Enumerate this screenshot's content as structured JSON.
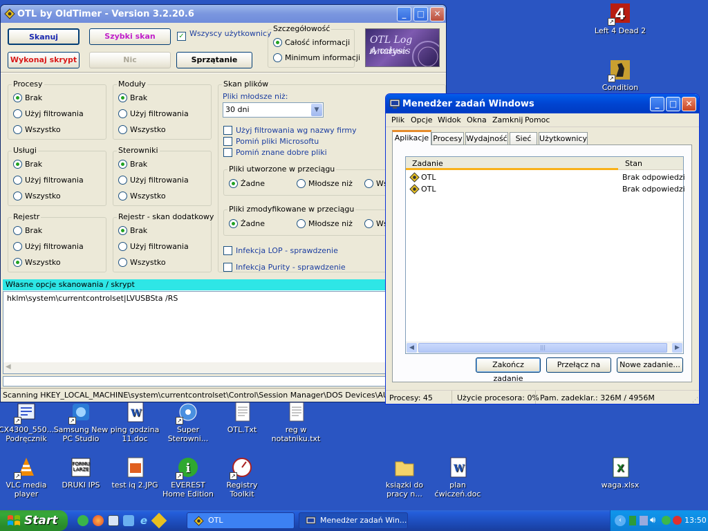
{
  "desktop_icons": [
    {
      "id": "l4d2",
      "label": "Left 4 Dead 2",
      "icon": "l4d2-icon",
      "shortcut": true
    },
    {
      "id": "cz",
      "label": "Condition Zero",
      "icon": "counter-strike-icon",
      "shortcut": true
    },
    {
      "id": "cx4300",
      "label": "CX4300_550... Podręcznik",
      "icon": "printer-manual-icon",
      "shortcut": true
    },
    {
      "id": "samsung",
      "label": "Samsung New PC Studio",
      "icon": "samsung-pc-studio-icon",
      "shortcut": true
    },
    {
      "id": "ping",
      "label": "ping godzina 11.doc",
      "icon": "word-document-icon",
      "shortcut": false
    },
    {
      "id": "super",
      "label": "Super Sterowni...",
      "icon": "driver-tool-icon",
      "shortcut": true
    },
    {
      "id": "otltxt",
      "label": "OTL.Txt",
      "icon": "text-file-icon",
      "shortcut": false
    },
    {
      "id": "reg",
      "label": "reg w notatniku.txt",
      "icon": "text-file-icon",
      "shortcut": false
    },
    {
      "id": "vlc",
      "label": "VLC media player",
      "icon": "vlc-icon",
      "shortcut": true
    },
    {
      "id": "druki",
      "label": "DRUKI IPS",
      "icon": "forms-icon",
      "shortcut": false
    },
    {
      "id": "testiq",
      "label": "test iq 2.JPG",
      "icon": "image-file-icon",
      "shortcut": false
    },
    {
      "id": "everest",
      "label": "EVEREST Home Edition",
      "icon": "everest-info-icon",
      "shortcut": true
    },
    {
      "id": "regtool",
      "label": "Registry Toolkit",
      "icon": "registry-toolkit-icon",
      "shortcut": true
    },
    {
      "id": "ksiazki",
      "label": "ksiązki do pracy n...",
      "icon": "folder-icon",
      "shortcut": false
    },
    {
      "id": "plan",
      "label": "plan ćwiczeń.doc",
      "icon": "word-document-icon",
      "shortcut": false
    },
    {
      "id": "waga",
      "label": "waga.xlsx",
      "icon": "excel-file-icon",
      "shortcut": false
    }
  ],
  "otl": {
    "title": "OTL by OldTimer - Version 3.2.20.6",
    "buttons": {
      "scan": "Skanuj",
      "quick_scan": "Szybki skan",
      "run_script": "Wykonaj skrypt",
      "nothing": "Nic",
      "cleanup": "Sprzątanie"
    },
    "all_users": "Wszyscy użytkownicy",
    "detail": {
      "title": "Szczegółowość",
      "full": "Całość informacji",
      "minimum": "Minimum informacji"
    },
    "logo": {
      "line1": "OTL Log Analysis",
      "line2": "By Oldtimer"
    },
    "groups": {
      "procesy": {
        "title": "Procesy",
        "options": [
          "Brak",
          "Użyj filtrowania",
          "Wszystko"
        ],
        "selected": 0
      },
      "moduly": {
        "title": "Moduły",
        "options": [
          "Brak",
          "Użyj filtrowania",
          "Wszystko"
        ],
        "selected": 0
      },
      "uslugi": {
        "title": "Usługi",
        "options": [
          "Brak",
          "Użyj filtrowania",
          "Wszystko"
        ],
        "selected": 0
      },
      "sterowniki": {
        "title": "Sterowniki",
        "options": [
          "Brak",
          "Użyj filtrowania",
          "Wszystko"
        ],
        "selected": 0
      },
      "rejestr": {
        "title": "Rejestr",
        "options": [
          "Brak",
          "Użyj filtrowania",
          "Wszystko"
        ],
        "selected": 2
      },
      "rejestr_dod": {
        "title": "Rejestr - skan dodatkowy",
        "options": [
          "Brak",
          "Użyj filtrowania",
          "Wszystko"
        ],
        "selected": 0
      }
    },
    "file_scan": {
      "title": "Skan plików",
      "younger_label": "Pliki młodsze niż:",
      "younger_value": "30 dni",
      "checks": [
        "Użyj filtrowania wg nazwy firmy",
        "Pomiń pliki Microsoftu",
        "Pomiń znane dobre pliki"
      ],
      "created": {
        "title": "Pliki utworzone w przeciągu",
        "options": [
          "Żadne",
          "Młodsze niż",
          "Ws"
        ]
      },
      "modified": {
        "title": "Pliki zmodyfikowane w przeciągu",
        "options": [
          "Żadne",
          "Młodsze niż",
          "Ws"
        ]
      },
      "lop": "Infekcja LOP - sprawdzenie",
      "purity": "Infekcja Purity - sprawdzenie"
    },
    "custom_label": "Własne opcje skanowania / skrypt",
    "custom_text": "hklm\\system\\currentcontrolset|LVUSBSta /RS",
    "status": "Scanning HKEY_LOCAL_MACHINE\\system\\currentcontrolset\\Control\\Session Manager\\DOS Devices\\AUX..."
  },
  "taskmgr": {
    "title": "Menedżer zadań Windows",
    "menu": [
      "Plik",
      "Opcje",
      "Widok",
      "Okna",
      "Zamknij",
      "Pomoc"
    ],
    "tabs": [
      "Aplikacje",
      "Procesy",
      "Wydajność",
      "Sieć",
      "Użytkownicy"
    ],
    "active_tab": 0,
    "columns": [
      "Zadanie",
      "Stan"
    ],
    "rows": [
      {
        "task": "OTL",
        "status": "Brak odpowiedzi"
      },
      {
        "task": "OTL",
        "status": "Brak odpowiedzi"
      }
    ],
    "buttons": {
      "end": "Zakończ zadanie",
      "switch": "Przełącz na",
      "new": "Nowe zadanie..."
    },
    "status": {
      "processes": "Procesy: 45",
      "cpu": "Użycie procesora: 0%",
      "commit": "Pam. zadeklar.: 326M / 4956M"
    }
  },
  "taskbar": {
    "start": "Start",
    "items": [
      {
        "label": "OTL",
        "active": false
      },
      {
        "label": "Menedżer zadań Win...",
        "active": true
      }
    ],
    "clock": "13:50"
  }
}
